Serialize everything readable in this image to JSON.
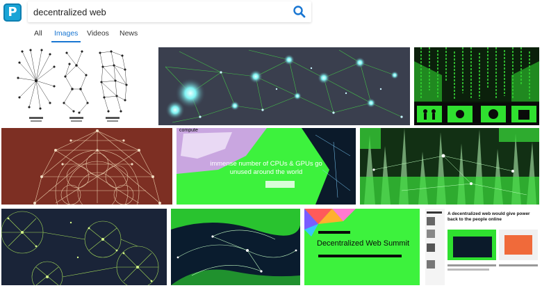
{
  "search": {
    "query": "decentralized web",
    "placeholder": ""
  },
  "tabs": [
    {
      "label": "All",
      "active": false
    },
    {
      "label": "Images",
      "active": true
    },
    {
      "label": "Videos",
      "active": false
    },
    {
      "label": "News",
      "active": false
    }
  ],
  "results": {
    "r5_text": "immense number of CPUs & GPUs go unused around the world",
    "r5_tag": "compute",
    "r8_title": "Decentralized Web Summit",
    "r9_headline": "A decentralized web would give power back to the people online"
  },
  "colors": {
    "accent": "#1976d2",
    "logo": "#19a4d6"
  },
  "icons": {
    "logo": "brand-logo-icon",
    "search": "search-icon"
  }
}
